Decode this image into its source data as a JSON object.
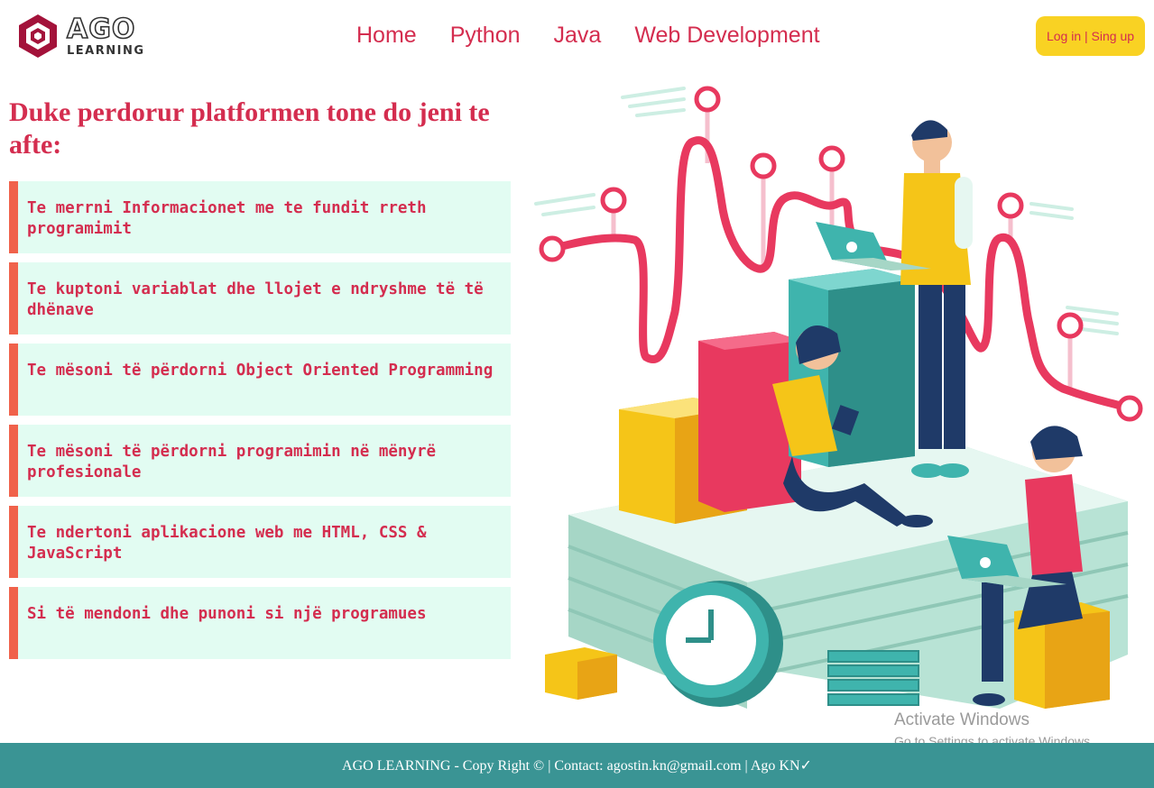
{
  "brand": {
    "name": "AGO",
    "tagline": "LEARNING"
  },
  "nav": {
    "items": [
      {
        "label": "Home"
      },
      {
        "label": "Python"
      },
      {
        "label": "Java"
      },
      {
        "label": "Web Development"
      }
    ]
  },
  "auth": {
    "login_label": "Log in | Sing up"
  },
  "main": {
    "headline": "Duke perdorur platformen tone do jeni te afte:",
    "features": [
      {
        "text": "Te merrni Informacionet me te fundit rreth programimit"
      },
      {
        "text": "Te kuptoni variablat dhe llojet e ndryshme të të dhënave"
      },
      {
        "text": "Te mësoni të përdorni Object Oriented Programming"
      },
      {
        "text": "Te mësoni të përdorni programimin në mënyrë profesionale"
      },
      {
        "text": "Te ndertoni aplikacione web me HTML, CSS & JavaScript"
      },
      {
        "text": "Si të mendoni dhe punoni si një programues"
      }
    ]
  },
  "watermark": {
    "title": "Activate Windows",
    "subtitle": "Go to Settings to activate Windows."
  },
  "footer": {
    "text": "AGO LEARNING - Copy Right © | Contact: agostin.kn@gmail.com | Ago KN✓"
  },
  "colors": {
    "accent": "#d42d4f",
    "button": "#f9d223",
    "feature_bg": "#e2fcf2",
    "feature_border": "#f0624b",
    "footer_bg": "#3a9494"
  }
}
